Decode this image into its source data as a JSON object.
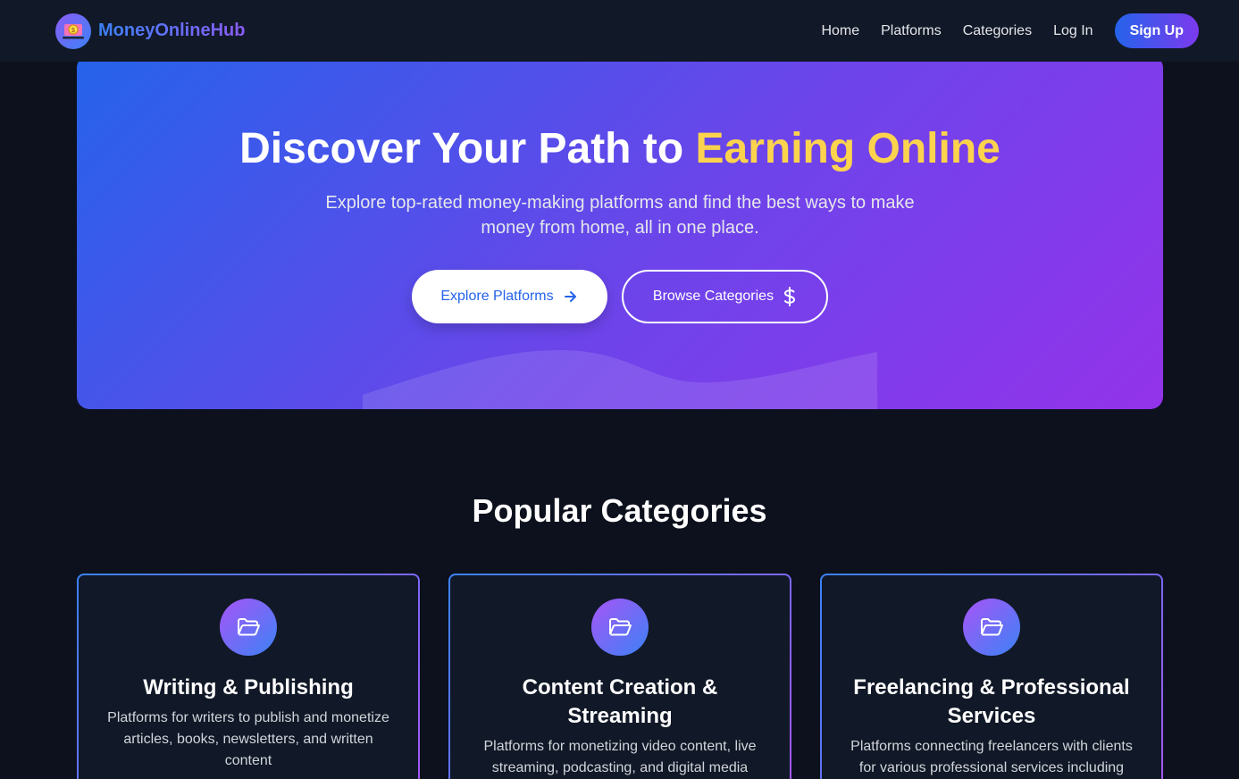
{
  "brand": {
    "name": "MoneyOnlineHub",
    "logo_icon": "money-laptop-icon"
  },
  "nav": {
    "links": [
      "Home",
      "Platforms",
      "Categories",
      "Log In"
    ],
    "signup_label": "Sign Up"
  },
  "hero": {
    "title_prefix": "Discover Your Path to ",
    "title_accent": "Earning Online",
    "subtitle": "Explore top-rated money-making platforms and find the best ways to make money from home, all in one place.",
    "primary_button": {
      "label": "Explore Platforms",
      "icon": "arrow-right-icon"
    },
    "secondary_button": {
      "label": "Browse Categories",
      "icon": "dollar-icon"
    }
  },
  "categories": {
    "section_title": "Popular Categories",
    "items": [
      {
        "title": "Writing & Publishing",
        "description": "Platforms for writers to publish and monetize articles, books, newsletters, and written content",
        "icon": "folder-open-icon"
      },
      {
        "title": "Content Creation & Streaming",
        "description": "Platforms for monetizing video content, live streaming, podcasting, and digital media",
        "icon": "folder-open-icon"
      },
      {
        "title": "Freelancing & Professional Services",
        "description": "Platforms connecting freelancers with clients for various professional services including",
        "icon": "folder-open-icon"
      }
    ]
  },
  "colors": {
    "page_bg": "#0c111d",
    "nav_bg": "#111827",
    "accent_blue": "#2563eb",
    "accent_purple": "#9333ea",
    "highlight_yellow": "#fcd34d"
  }
}
